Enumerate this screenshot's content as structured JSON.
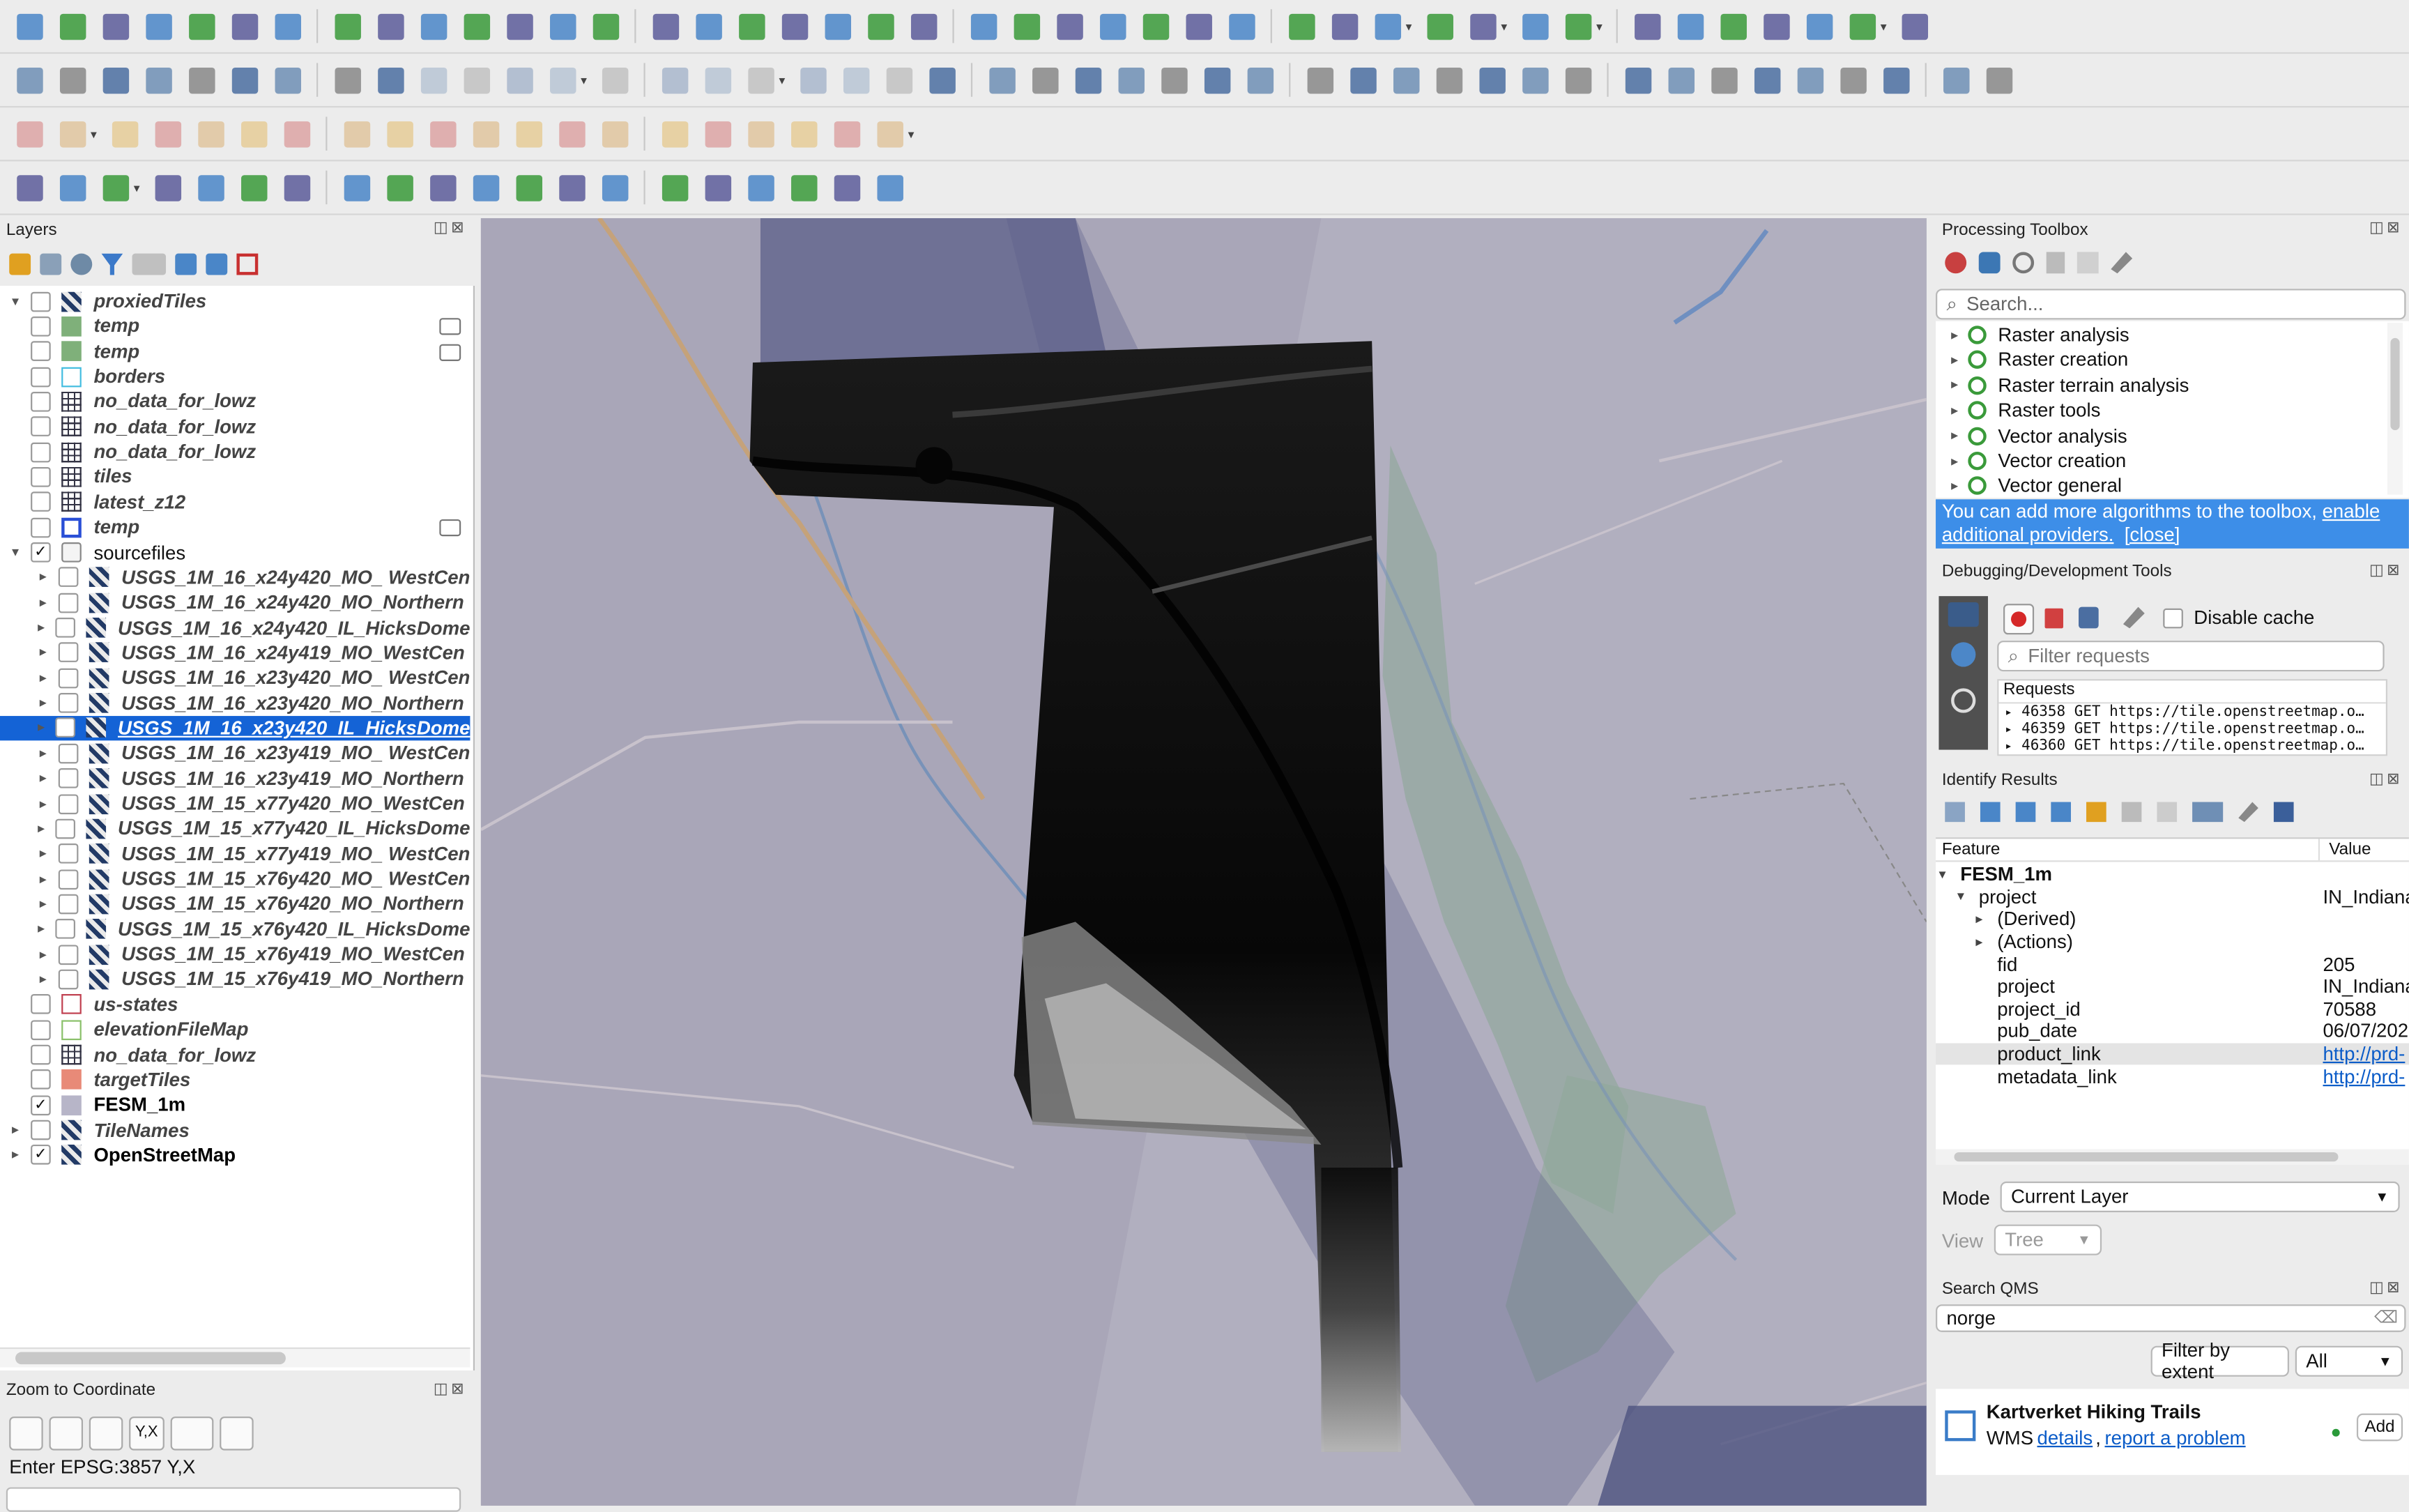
{
  "toolbar": {
    "placeholder": ""
  },
  "layers_panel": {
    "title": "Layers",
    "items": [
      {
        "label": "proxiedTiles",
        "style": "it",
        "checked": false,
        "arrow": "▾",
        "indent": 0,
        "sym": "raster"
      },
      {
        "label": "temp",
        "style": "it",
        "checked": false,
        "arrow": "",
        "indent": 1,
        "sym": "fillgreen"
      },
      {
        "label": "temp",
        "style": "it",
        "checked": false,
        "arrow": "",
        "indent": 1,
        "sym": "fillgreen"
      },
      {
        "label": "borders",
        "style": "it",
        "checked": false,
        "arrow": "",
        "indent": 1,
        "sym": "outlinecyan"
      },
      {
        "label": "no_data_for_lowz",
        "style": "it",
        "checked": false,
        "arrow": "",
        "indent": 1,
        "sym": "grid"
      },
      {
        "label": "no_data_for_lowz",
        "style": "it",
        "checked": false,
        "arrow": "",
        "indent": 1,
        "sym": "grid"
      },
      {
        "label": "no_data_for_lowz",
        "style": "it",
        "checked": false,
        "arrow": "",
        "indent": 1,
        "sym": "grid"
      },
      {
        "label": "tiles",
        "style": "it",
        "checked": false,
        "arrow": "",
        "indent": 1,
        "sym": "grid"
      },
      {
        "label": "latest_z12",
        "style": "it",
        "checked": false,
        "arrow": "",
        "indent": 1,
        "sym": "grid"
      },
      {
        "label": "temp",
        "style": "it",
        "checked": false,
        "arrow": "",
        "indent": 1,
        "sym": "outlineblue"
      },
      {
        "label": "sourcefiles",
        "style": "norm",
        "checked": true,
        "arrow": "▾",
        "indent": 0,
        "sym": "group"
      },
      {
        "label": "USGS_1M_16_x24y420_MO_ WestCen",
        "style": "it",
        "checked": false,
        "arrow": "▸",
        "indent": 2,
        "sym": "raster"
      },
      {
        "label": "USGS_1M_16_x24y420_MO_Northern",
        "style": "it",
        "checked": false,
        "arrow": "▸",
        "indent": 2,
        "sym": "raster"
      },
      {
        "label": "USGS_1M_16_x24y420_IL_HicksDome",
        "style": "it",
        "checked": false,
        "arrow": "▸",
        "indent": 2,
        "sym": "raster"
      },
      {
        "label": "USGS_1M_16_x24y419_MO_WestCen",
        "style": "it",
        "checked": false,
        "arrow": "▸",
        "indent": 2,
        "sym": "raster"
      },
      {
        "label": "USGS_1M_16_x23y420_MO_ WestCen",
        "style": "it",
        "checked": false,
        "arrow": "▸",
        "indent": 2,
        "sym": "raster"
      },
      {
        "label": "USGS_1M_16_x23y420_MO_Northern",
        "style": "it",
        "checked": false,
        "arrow": "▸",
        "indent": 2,
        "sym": "raster"
      },
      {
        "label": "USGS_1M_16_x23y420_IL_HicksDome",
        "style": "sel",
        "checked": true,
        "arrow": "▸",
        "indent": 2,
        "sym": "raster"
      },
      {
        "label": "USGS_1M_16_x23y419_MO_ WestCen",
        "style": "it",
        "checked": false,
        "arrow": "▸",
        "indent": 2,
        "sym": "raster"
      },
      {
        "label": "USGS_1M_16_x23y419_MO_Northern",
        "style": "it",
        "checked": false,
        "arrow": "▸",
        "indent": 2,
        "sym": "raster"
      },
      {
        "label": "USGS_1M_15_x77y420_MO_WestCen",
        "style": "it",
        "checked": false,
        "arrow": "▸",
        "indent": 2,
        "sym": "raster"
      },
      {
        "label": "USGS_1M_15_x77y420_IL_HicksDome",
        "style": "it",
        "checked": false,
        "arrow": "▸",
        "indent": 2,
        "sym": "raster"
      },
      {
        "label": "USGS_1M_15_x77y419_MO_ WestCen",
        "style": "it",
        "checked": false,
        "arrow": "▸",
        "indent": 2,
        "sym": "raster"
      },
      {
        "label": "USGS_1M_15_x76y420_MO_ WestCen",
        "style": "it",
        "checked": false,
        "arrow": "▸",
        "indent": 2,
        "sym": "raster"
      },
      {
        "label": "USGS_1M_15_x76y420_MO_Northern",
        "style": "it",
        "checked": false,
        "arrow": "▸",
        "indent": 2,
        "sym": "raster"
      },
      {
        "label": "USGS_1M_15_x76y420_IL_HicksDome",
        "style": "it",
        "checked": false,
        "arrow": "▸",
        "indent": 2,
        "sym": "raster"
      },
      {
        "label": "USGS_1M_15_x76y419_MO_WestCen",
        "style": "it",
        "checked": false,
        "arrow": "▸",
        "indent": 2,
        "sym": "raster"
      },
      {
        "label": "USGS_1M_15_x76y419_MO_Northern",
        "style": "it",
        "checked": false,
        "arrow": "▸",
        "indent": 2,
        "sym": "raster"
      },
      {
        "label": "us-states",
        "style": "it",
        "checked": false,
        "arrow": "",
        "indent": 1,
        "sym": "outlinered"
      },
      {
        "label": "elevationFileMap",
        "style": "it",
        "checked": false,
        "arrow": "",
        "indent": 1,
        "sym": "outlinegreen"
      },
      {
        "label": "no_data_for_lowz",
        "style": "it",
        "checked": false,
        "arrow": "",
        "indent": 1,
        "sym": "grid"
      },
      {
        "label": "targetTiles",
        "style": "it",
        "checked": false,
        "arrow": "",
        "indent": 1,
        "sym": "fillsalmon"
      },
      {
        "label": "FESM_1m",
        "style": "bold",
        "checked": true,
        "arrow": "",
        "indent": 1,
        "sym": "fillgray"
      },
      {
        "label": "TileNames",
        "style": "it",
        "checked": false,
        "arrow": "▸",
        "indent": 0,
        "sym": "raster"
      },
      {
        "label": "OpenStreetMap",
        "style": "bold",
        "checked": true,
        "arrow": "▸",
        "indent": 0,
        "sym": "raster"
      }
    ]
  },
  "zoom_panel": {
    "title": "Zoom to Coordinate",
    "yx_label": "Y,X",
    "hint": "Enter EPSG:3857 Y,X"
  },
  "processing": {
    "title": "Processing Toolbox",
    "search_placeholder": "Search...",
    "items": [
      "Raster analysis",
      "Raster creation",
      "Raster terrain analysis",
      "Raster tools",
      "Vector analysis",
      "Vector creation",
      "Vector general"
    ],
    "info_text": "You can add more algorithms to the toolbox, ",
    "info_link": "enable additional providers.",
    "info_close": "[close]"
  },
  "debug": {
    "title": "Debugging/Development Tools",
    "disable_cache": "Disable cache",
    "filter_placeholder": "Filter requests",
    "requests_header": "Requests",
    "requests": [
      "46358 GET https://tile.openstreetmap.o…",
      "46359 GET https://tile.openstreetmap.o…",
      "46360 GET https://tile.openstreetmap.o…"
    ]
  },
  "identify": {
    "title": "Identify Results",
    "col_feature": "Feature",
    "col_value": "Value",
    "rows": [
      {
        "f": "FESM_1m",
        "v": "",
        "ind": 0,
        "arrow": "▾",
        "bold": true,
        "link": false,
        "hl": false
      },
      {
        "f": "project",
        "v": "IN_Indiana",
        "ind": 1,
        "arrow": "▾",
        "bold": false,
        "link": false,
        "hl": false
      },
      {
        "f": "(Derived)",
        "v": "",
        "ind": 2,
        "arrow": "▸",
        "bold": false,
        "link": false,
        "hl": false
      },
      {
        "f": "(Actions)",
        "v": "",
        "ind": 2,
        "arrow": "▸",
        "bold": false,
        "link": false,
        "hl": false
      },
      {
        "f": "fid",
        "v": "205",
        "ind": 2,
        "arrow": "",
        "bold": false,
        "link": false,
        "hl": false
      },
      {
        "f": "project",
        "v": "IN_Indiana",
        "ind": 2,
        "arrow": "",
        "bold": false,
        "link": false,
        "hl": false
      },
      {
        "f": "project_id",
        "v": "70588",
        "ind": 2,
        "arrow": "",
        "bold": false,
        "link": false,
        "hl": false
      },
      {
        "f": "pub_date",
        "v": "06/07/202",
        "ind": 2,
        "arrow": "",
        "bold": false,
        "link": false,
        "hl": false
      },
      {
        "f": "product_link",
        "v": "http://prd-",
        "ind": 2,
        "arrow": "",
        "bold": false,
        "link": true,
        "hl": true
      },
      {
        "f": "metadata_link",
        "v": "http://prd-",
        "ind": 2,
        "arrow": "",
        "bold": false,
        "link": true,
        "hl": false
      }
    ],
    "mode_label": "Mode",
    "mode_value": "Current Layer",
    "view_label": "View",
    "view_value": "Tree"
  },
  "qms": {
    "title": "Search QMS",
    "query": "norge",
    "filter_btn": "Filter by extent",
    "filter_value": "All",
    "result_title": "Kartverket Hiking Trails",
    "result_type": "WMS",
    "result_details": "details",
    "result_sep": ",",
    "result_report": "report a problem",
    "add_btn": "Add"
  },
  "colors": {
    "selection": "#1463d6",
    "accent_link": "#0b5cc8",
    "info_bg": "#3d8ee8"
  }
}
